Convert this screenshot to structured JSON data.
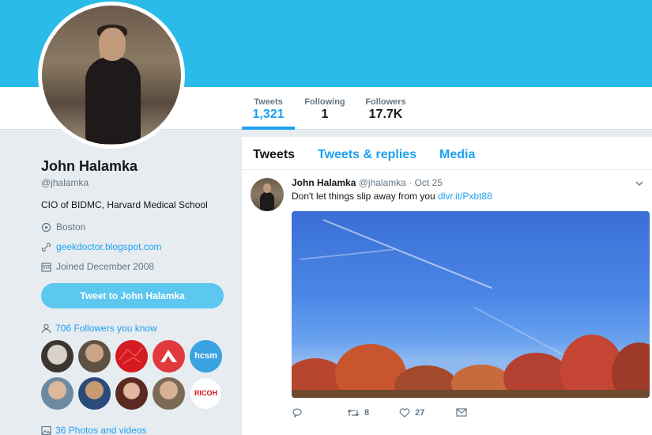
{
  "nav": {
    "tweets_label": "Tweets",
    "tweets_value": "1,321",
    "following_label": "Following",
    "following_value": "1",
    "followers_label": "Followers",
    "followers_value": "17.7K"
  },
  "profile": {
    "name": "John Halamka",
    "handle": "@jhalamka",
    "bio": "CIO of BIDMC, Harvard Medical School",
    "location": "Boston",
    "website": "geekdoctor.blogspot.com",
    "joined": "Joined December 2008",
    "tweet_to_button": "Tweet to John Halamka",
    "followers_you_know": "706 Followers you know",
    "photos_videos": "36 Photos and videos",
    "known_followers": [
      "hcsm",
      "RICOH"
    ]
  },
  "timeline": {
    "tabs": [
      "Tweets",
      "Tweets & replies",
      "Media"
    ],
    "tweet": {
      "author": "John Halamka",
      "handle": "@jhalamka · Oct 25",
      "text": "Don't let things slip away from you ",
      "link": "dlvr.it/Pxbt88",
      "retweets": "8",
      "likes": "27"
    }
  },
  "colors": {
    "banner": "#2bbbe8",
    "accent": "#1da1f2",
    "button": "#5cc8ef"
  }
}
